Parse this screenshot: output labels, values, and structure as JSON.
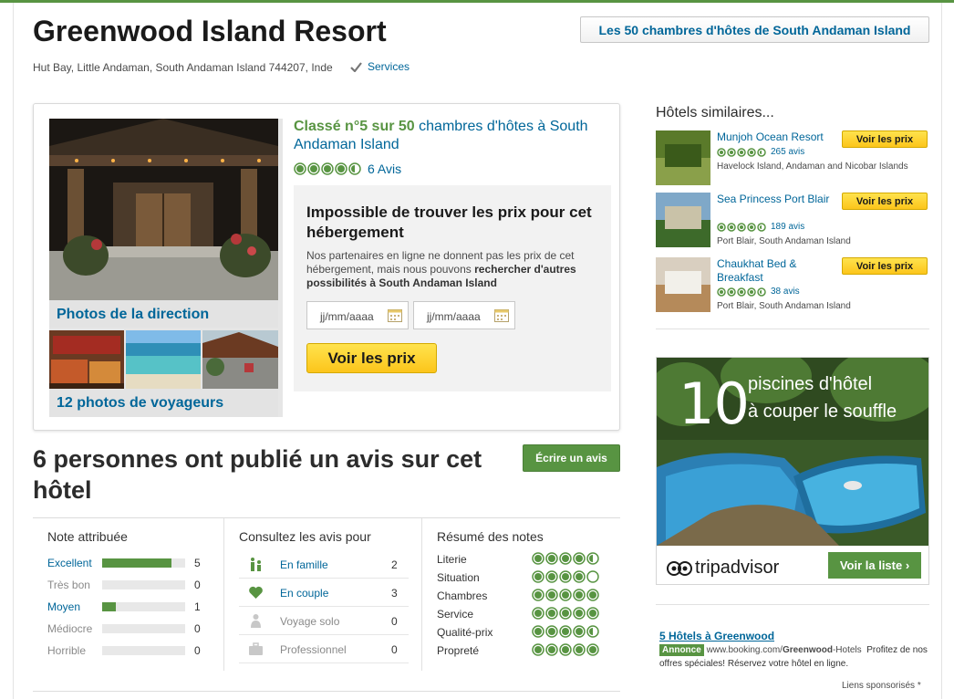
{
  "header": {
    "hotel_name": "Greenwood Island Resort",
    "address": "Hut Bay, Little Andaman, South Andaman Island 744207, Inde",
    "services_label": "Services",
    "top_link": "Les 50 chambres d'hôtes de South Andaman Island"
  },
  "photos": {
    "direction_label": "Photos de la direction",
    "travelers_label": "12 photos de voyageurs"
  },
  "ranking": {
    "rank_text": "Classé n°5 sur 50",
    "rank_suffix": "chambres d'hôtes à South Andaman Island",
    "rating": 4.5,
    "reviews_label": "6 Avis"
  },
  "price_box": {
    "title": "Impossible de trouver les prix pour cet hébergement",
    "text_before": "Nos partenaires en ligne ne donnent pas les prix de cet hébergement, mais nous pouvons",
    "text_bold": "rechercher d'autres possibilités à South Andaman Island",
    "checkin_placeholder": "jj/mm/aaaa",
    "checkout_placeholder": "jj/mm/aaaa",
    "button": "Voir les prix"
  },
  "reviews": {
    "heading": "6 personnes ont publié un avis sur cet hôtel",
    "write_button": "Écrire un avis",
    "note_header": "Note attribuée",
    "scores": [
      {
        "label": "Excellent",
        "count": "5",
        "fraction": 0.833,
        "link": true
      },
      {
        "label": "Très bon",
        "count": "0",
        "fraction": 0,
        "link": false
      },
      {
        "label": "Moyen",
        "count": "1",
        "fraction": 0.167,
        "link": true
      },
      {
        "label": "Médiocre",
        "count": "0",
        "fraction": 0,
        "link": false
      },
      {
        "label": "Horrible",
        "count": "0",
        "fraction": 0,
        "link": false
      }
    ],
    "traveler_header": "Consultez les avis pour",
    "traveler_types": [
      {
        "label": "En famille",
        "count": "2",
        "icon": "family-icon",
        "link": true
      },
      {
        "label": "En couple",
        "count": "3",
        "icon": "heart-icon",
        "link": true
      },
      {
        "label": "Voyage solo",
        "count": "0",
        "icon": "person-icon",
        "link": false
      },
      {
        "label": "Professionnel",
        "count": "0",
        "icon": "briefcase-icon",
        "link": false
      }
    ],
    "summary_header": "Résumé des notes",
    "summary": [
      {
        "label": "Literie",
        "rating": 4.5
      },
      {
        "label": "Situation",
        "rating": 4
      },
      {
        "label": "Chambres",
        "rating": 5
      },
      {
        "label": "Service",
        "rating": 5
      },
      {
        "label": "Qualité-prix",
        "rating": 4.5
      },
      {
        "label": "Propreté",
        "rating": 5
      }
    ]
  },
  "similar": {
    "title": "Hôtels similaires...",
    "button": "Voir les prix",
    "items": [
      {
        "name": "Munjoh Ocean Resort",
        "reviews": "265 avis",
        "rating": 4.5,
        "location": "Havelock Island, Andaman and Nicobar Islands"
      },
      {
        "name": "Sea Princess Port Blair",
        "reviews": "189 avis",
        "rating": 4.5,
        "location": "Port Blair, South Andaman Island"
      },
      {
        "name": "Chaukhat Bed & Breakfast",
        "reviews": "38 avis",
        "rating": 4.5,
        "location": "Port Blair, South Andaman Island"
      }
    ]
  },
  "ad": {
    "number": "10",
    "line1": "piscines d'hôtel",
    "line2": "à couper le souffle",
    "brand": "tripadvisor",
    "button": "Voir la liste ›"
  },
  "sponsor": {
    "title": "5 Hôtels à Greenwood",
    "badge": "Annonce",
    "url_pre": "www.booking.com/",
    "url_bold": "Greenwood",
    "url_post": "-Hotels",
    "text": "Profitez de nos offres spéciales! Réservez votre hôtel en ligne.",
    "footer": "Liens sponsorisés *"
  },
  "colors": {
    "brand_green": "#589442",
    "link_blue": "#006699",
    "price_yellow": "#fcc51b"
  }
}
